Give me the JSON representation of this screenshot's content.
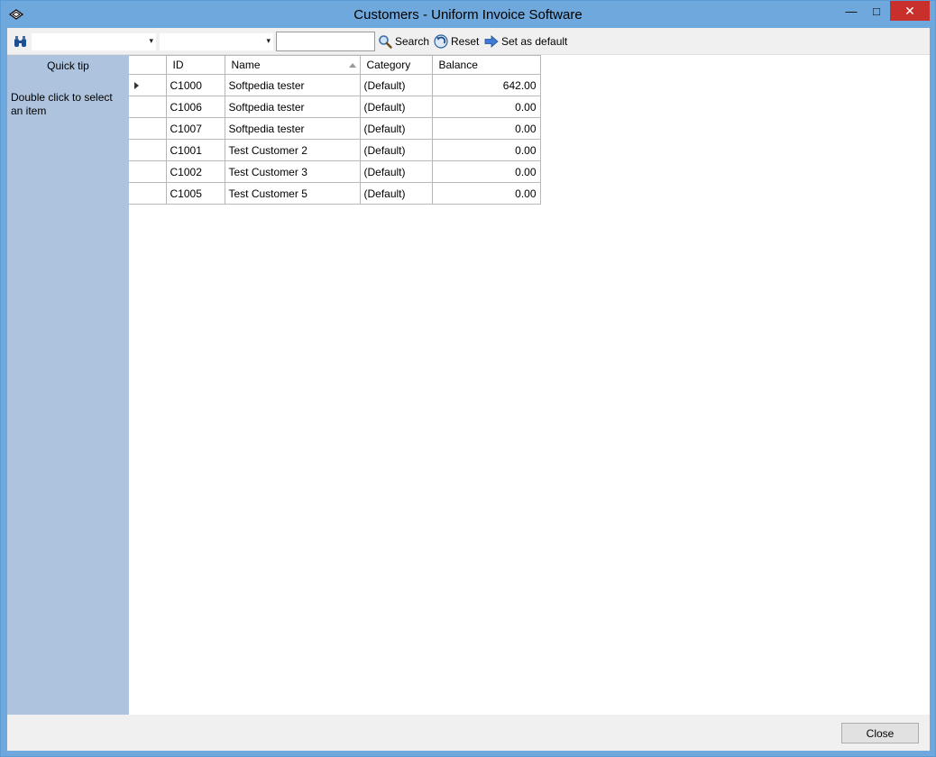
{
  "window": {
    "title": "Customers - Uniform Invoice Software",
    "minimize_glyph": "—",
    "maximize_glyph": "□",
    "close_glyph": "✕"
  },
  "toolbar": {
    "combo1_value": "",
    "combo2_value": "",
    "combo_arrow": "▾",
    "search_value": "",
    "search_label": "Search",
    "reset_label": "Reset",
    "default_label": "Set as default"
  },
  "sidebar": {
    "title": "Quick tip",
    "tip": "Double click to select an item"
  },
  "grid": {
    "columns": [
      "ID",
      "Name",
      "Category",
      "Balance"
    ],
    "rows": [
      {
        "id": "C1000",
        "name": "Softpedia tester",
        "category": "(Default)",
        "balance": "642.00"
      },
      {
        "id": "C1006",
        "name": "Softpedia tester",
        "category": "(Default)",
        "balance": "0.00"
      },
      {
        "id": "C1007",
        "name": "Softpedia tester",
        "category": "(Default)",
        "balance": "0.00"
      },
      {
        "id": "C1001",
        "name": "Test Customer 2",
        "category": "(Default)",
        "balance": "0.00"
      },
      {
        "id": "C1002",
        "name": "Test Customer 3",
        "category": "(Default)",
        "balance": "0.00"
      },
      {
        "id": "C1005",
        "name": "Test Customer 5",
        "category": "(Default)",
        "balance": "0.00"
      }
    ]
  },
  "footer": {
    "close_label": "Close"
  },
  "colors": {
    "titlebar": "#6fa8dc",
    "sidebar": "#adc3de",
    "close_button_red": "#c9302c"
  }
}
